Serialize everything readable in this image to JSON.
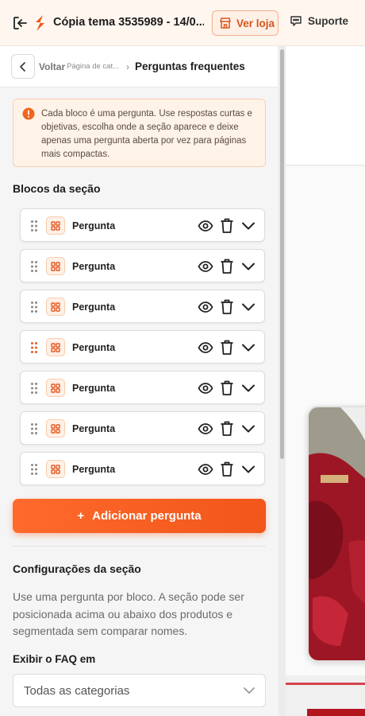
{
  "topbar": {
    "title": "Cópia tema 3535989 - 14/0...",
    "ver_loja": "Ver loja",
    "suporte": "Suporte"
  },
  "breadcrumb": {
    "back": "Voltar",
    "parent": "Página de cat...",
    "separator": "›",
    "current": "Perguntas frequentes"
  },
  "alert": {
    "text": "Cada bloco é uma pergunta. Use respostas curtas e objetivas, escolha onde a seção aparece e deixe apenas uma pergunta aberta por vez para páginas mais compactas."
  },
  "blocks_section": {
    "title": "Blocos da seção",
    "items": [
      {
        "label": "Pergunta"
      },
      {
        "label": "Pergunta"
      },
      {
        "label": "Pergunta"
      },
      {
        "label": "Pergunta"
      },
      {
        "label": "Pergunta"
      },
      {
        "label": "Pergunta"
      },
      {
        "label": "Pergunta"
      }
    ],
    "add_label": "Adicionar pergunta",
    "add_icon": "+"
  },
  "config": {
    "title": "Configurações da seção",
    "description": "Use uma pergunta por bloco. A seção pode ser posicionada acima ou abaixo dos produtos e segmentada sem comparar nomes.",
    "display_label": "Exibir o FAQ em",
    "display_value": "Todas as categorias"
  },
  "colors": {
    "accent": "#f1561a",
    "highlight_handle": "#e35b26"
  }
}
